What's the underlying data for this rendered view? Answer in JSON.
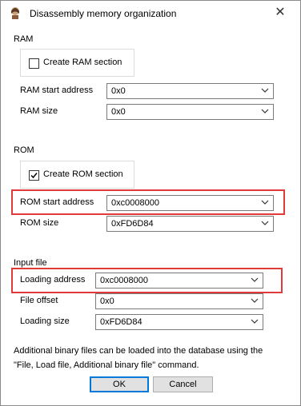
{
  "window": {
    "title": "Disassembly memory organization",
    "icon": "app-icon",
    "close_glyph": "✕"
  },
  "ram": {
    "group_label": "RAM",
    "create_label": "Create RAM section",
    "create_checked": false,
    "start_label": "RAM start address",
    "start_value": "0x0",
    "size_label": "RAM size",
    "size_value": "0x0"
  },
  "rom": {
    "group_label": "ROM",
    "create_label": "Create ROM section",
    "create_checked": true,
    "start_label": "ROM start address",
    "start_value": "0xc0008000",
    "size_label": "ROM size",
    "size_value": "0xFD6D84"
  },
  "input_file": {
    "group_label": "Input file",
    "loading_address_label": "Loading address",
    "loading_address_value": "0xc0008000",
    "file_offset_label": "File offset",
    "file_offset_value": "0x0",
    "loading_size_label": "Loading size",
    "loading_size_value": "0xFD6D84"
  },
  "info": {
    "line1": "Additional binary files can be loaded into the database using the",
    "line2": "\"File, Load file, Additional binary file\" command."
  },
  "buttons": {
    "ok_label": "OK",
    "cancel_label": "Cancel"
  },
  "colors": {
    "highlight": "#e03a3a",
    "default_button_border": "#0078d7"
  }
}
